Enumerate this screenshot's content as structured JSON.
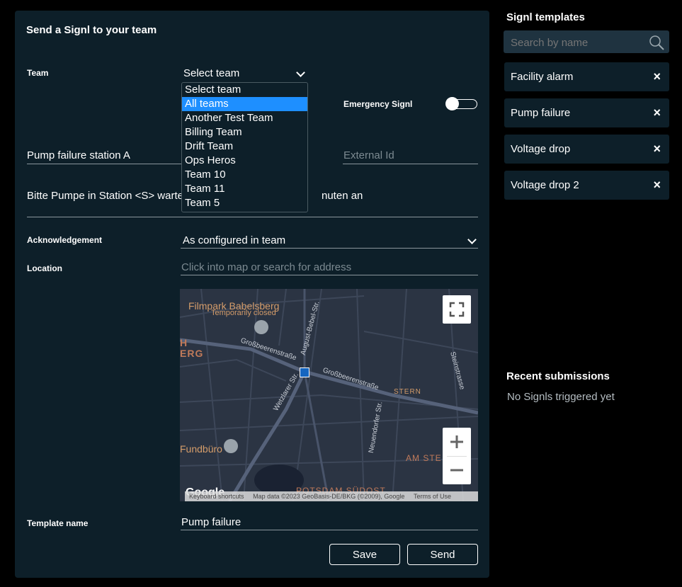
{
  "form": {
    "title": "Send a Signl to your team",
    "team_label": "Team",
    "team_value": "Select team",
    "team_options": [
      "Select team",
      "All teams",
      "Another Test Team",
      "Billing Team",
      "Drift Team",
      "Ops Heros",
      "Team 10",
      "Team 11",
      "Team 5"
    ],
    "team_highlighted": "All teams",
    "emergency_label": "Emergency Signl",
    "emergency_on": false,
    "subject_value": "Pump failure station A",
    "external_id_placeholder": "External Id",
    "message_value_start": "Bitte Pumpe in Station <S> warter",
    "message_value_end": "nuten an",
    "ack_label": "Acknowledgement",
    "ack_value": "As configured in team",
    "location_label": "Location",
    "location_placeholder": "Click into map or search for address",
    "template_name_label": "Template name",
    "template_name_value": "Pump failure",
    "save_label": "Save",
    "send_label": "Send"
  },
  "map": {
    "labels": {
      "filmpark": "Filmpark Babelsberg",
      "temp_closed": "Temporarily closed",
      "h": "H",
      "erg": "ERG",
      "grossbeeren1": "Großbeerenstraße",
      "grossbeeren2": "Großbeerenstraße",
      "august_bebel": "August-Bebel-Str.",
      "stern": "STERN",
      "steinstrasse": "Steinstrasse",
      "wetzlarer": "Wetzlarer Str.",
      "neuendorfer": "Neuendorfer Str.",
      "fundburo": "Fundbüro",
      "am_stern": "AM STE",
      "potsdam": "POTSDAM SÜDOST",
      "google": "Google",
      "shortcuts": "Keyboard shortcuts",
      "mapdata": "Map data ©2023 GeoBasis-DE/BKG (©2009), Google",
      "terms": "Terms of Use"
    }
  },
  "sidebar": {
    "templates_title": "Signl templates",
    "search_placeholder": "Search by name",
    "templates": [
      "Facility alarm",
      "Pump failure",
      "Voltage drop",
      "Voltage drop 2"
    ],
    "recent_title": "Recent submissions",
    "recent_empty": "No Signls triggered yet"
  }
}
